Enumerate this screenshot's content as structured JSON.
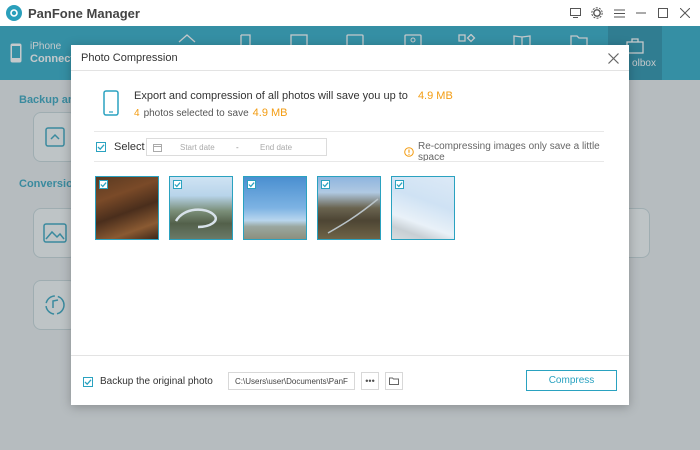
{
  "app": {
    "title": "PanFone Manager"
  },
  "window_controls": [
    "screen-icon",
    "gear-icon",
    "menu-icon",
    "minimize-icon",
    "maximize-icon",
    "close-icon"
  ],
  "device": {
    "name": "iPhone",
    "status": "Connecte"
  },
  "toolbar": {
    "icons": [
      "home-icon",
      "music-icon",
      "video-icon",
      "photo-icon",
      "contacts-icon",
      "apps-icon",
      "books-icon",
      "files-icon"
    ],
    "active_tab": "olbox"
  },
  "background": {
    "section1": "Backup and",
    "section2": "Conversion"
  },
  "dialog": {
    "title": "Photo Compression",
    "summary_text": "Export and compression of all photos will save you up to",
    "summary_amount": "4.9 MB",
    "selected_count": "4",
    "selected_text": "photos selected to save",
    "selected_amount": "4.9 MB",
    "select_label": "Select",
    "start_date_placeholder": "Start date",
    "date_separator": "-",
    "end_date_placeholder": "End date",
    "recompress_note": "Re-compressing images only save a little space",
    "photos": [
      {
        "name": "autumn forest aerial",
        "checked": true
      },
      {
        "name": "river bend aerial",
        "checked": true
      },
      {
        "name": "blue sky horizon",
        "checked": true
      },
      {
        "name": "river valley aerial",
        "checked": true
      },
      {
        "name": "hazy sky",
        "checked": true
      }
    ],
    "backup_label": "Backup the original photo",
    "backup_path": "C:\\Users\\user\\Documents\\PanFone",
    "more_label": "•••",
    "compress_label": "Compress"
  },
  "colors": {
    "accent": "#23a6c4",
    "highlight": "#f39c12"
  }
}
